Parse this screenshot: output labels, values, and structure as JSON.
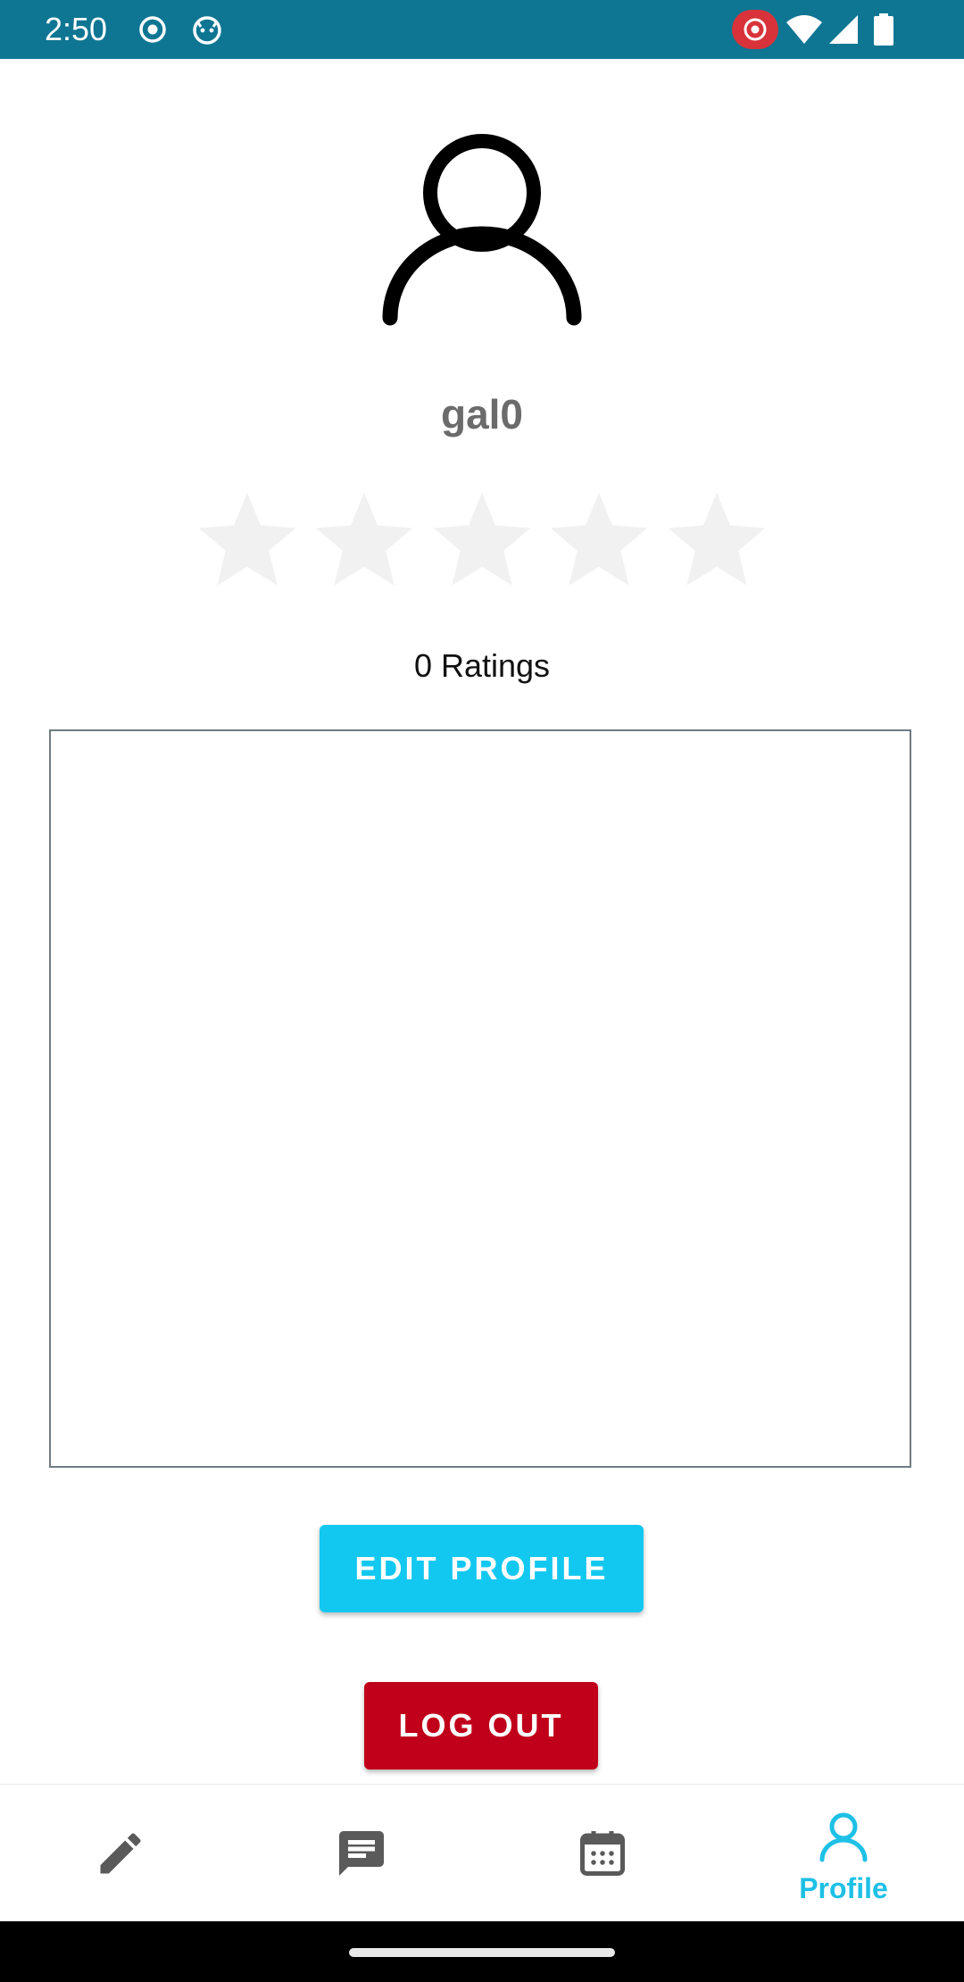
{
  "status_bar": {
    "time": "2:50",
    "background": "#0e7693",
    "left_icons": [
      "record-icon",
      "cat-face-icon"
    ],
    "right_icons": [
      "screen-record-icon",
      "wifi-icon",
      "cellular-signal-icon",
      "battery-icon"
    ]
  },
  "profile": {
    "avatar_icon": "person-outline-icon",
    "username": "gal0",
    "rating": {
      "value": 0,
      "max": 5
    },
    "ratings_label": "0 Ratings",
    "bio": ""
  },
  "buttons": {
    "edit_profile": {
      "label": "EDIT PROFILE",
      "color": "#13c8f0"
    },
    "logout": {
      "label": "LOG OUT",
      "color": "#c0001a"
    }
  },
  "bottom_nav": {
    "items": [
      {
        "icon": "pencil-icon",
        "label": "",
        "active": false
      },
      {
        "icon": "message-icon",
        "label": "",
        "active": false
      },
      {
        "icon": "calendar-icon",
        "label": "",
        "active": false
      },
      {
        "icon": "person-icon",
        "label": "Profile",
        "active": true
      }
    ],
    "active_color": "#1ec0e6",
    "inactive_color": "#5a5a5a"
  }
}
